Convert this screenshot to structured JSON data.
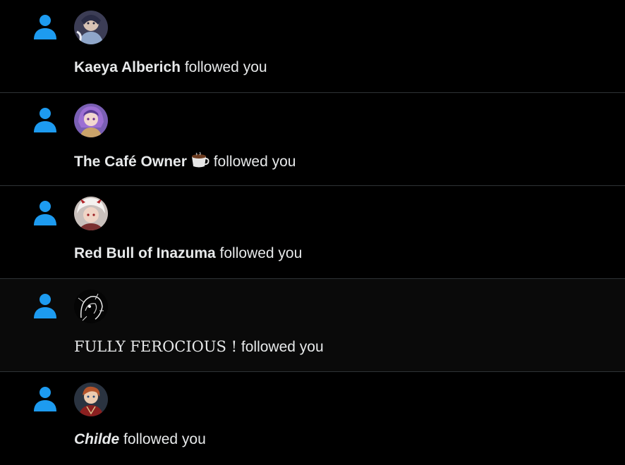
{
  "colors": {
    "background": "#000000",
    "accent": "#1d9bf0",
    "divider": "#2f3336",
    "text": "#e7e9ea"
  },
  "notifications": [
    {
      "icon": "person-icon",
      "name": "Kaeya Alberich",
      "emoji": "",
      "action": "followed you"
    },
    {
      "icon": "person-icon",
      "name": "The Café Owner",
      "emoji": "coffee-cup-icon",
      "action": "followed you"
    },
    {
      "icon": "person-icon",
      "name": "Red Bull of Inazuma",
      "emoji": "",
      "action": "followed you"
    },
    {
      "icon": "person-icon",
      "name": "FULLY FEROCIOUS !",
      "emoji": "",
      "action": "followed you"
    },
    {
      "icon": "person-icon",
      "name": "Childe",
      "emoji": "",
      "action": "followed you"
    }
  ]
}
